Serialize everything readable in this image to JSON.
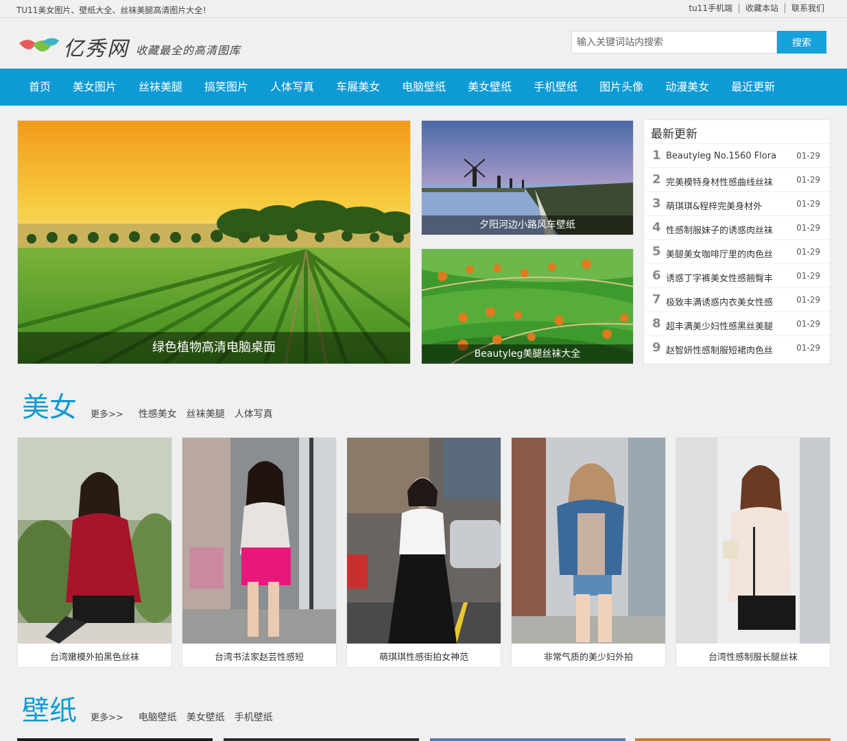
{
  "topbar": {
    "slogan": "TU11美女图片、壁纸大全、丝袜美腿高清图片大全！",
    "links": [
      "tu11手机端",
      "收藏本站",
      "联系我们"
    ]
  },
  "header": {
    "logo_name": "亿秀网",
    "logo_tagline": "收藏最全的高清图库",
    "search_placeholder": "输入关键词站内搜索",
    "search_button": "搜索"
  },
  "nav": [
    "首页",
    "美女图片",
    "丝袜美腿",
    "搞笑图片",
    "人体写真",
    "车展美女",
    "电脑壁纸",
    "美女壁纸",
    "手机壁纸",
    "图片头像",
    "动漫美女",
    "最近更新"
  ],
  "hero": {
    "big_caption": "绿色植物高清电脑桌面",
    "small1_caption": "夕阳河边小路风车壁纸",
    "small2_caption": "Beautyleg美腿丝袜大全"
  },
  "latest": {
    "title": "最新更新",
    "items": [
      {
        "num": "1",
        "title": "Beautyleg No.1560 Flora",
        "date": "01-29"
      },
      {
        "num": "2",
        "title": "完美模特身材性感曲线丝袜",
        "date": "01-29"
      },
      {
        "num": "3",
        "title": "萌琪琪&程梓完美身材外",
        "date": "01-29"
      },
      {
        "num": "4",
        "title": "性感制服妹子的诱惑肉丝袜",
        "date": "01-29"
      },
      {
        "num": "5",
        "title": "美腿美女咖啡厅里的肉色丝",
        "date": "01-29"
      },
      {
        "num": "6",
        "title": "诱惑丁字裤美女性感翘臀丰",
        "date": "01-29"
      },
      {
        "num": "7",
        "title": "极致丰满诱惑内衣美女性感",
        "date": "01-29"
      },
      {
        "num": "8",
        "title": "超丰满美少妇性感黑丝美腿",
        "date": "01-29"
      },
      {
        "num": "9",
        "title": "赵智妍性感制服短裙肉色丝",
        "date": "01-29"
      }
    ]
  },
  "section_beauty": {
    "title": "美女",
    "more": "更多>>",
    "tags": [
      "性感美女",
      "丝袜美腿",
      "人体写真"
    ],
    "cards": [
      "台湾嫩模外拍黑色丝袜",
      "台湾书法家赵芸性感短",
      "萌琪琪性感街拍女神范",
      "非常气质的美少妇外拍",
      "台湾性感制服长腿丝袜"
    ]
  },
  "section_wallpaper": {
    "title": "壁纸",
    "more": "更多>>",
    "tags": [
      "电脑壁纸",
      "美女壁纸",
      "手机壁纸"
    ]
  },
  "colors": {
    "accent": "#0e9ad4",
    "search_button": "#15a1d9"
  }
}
